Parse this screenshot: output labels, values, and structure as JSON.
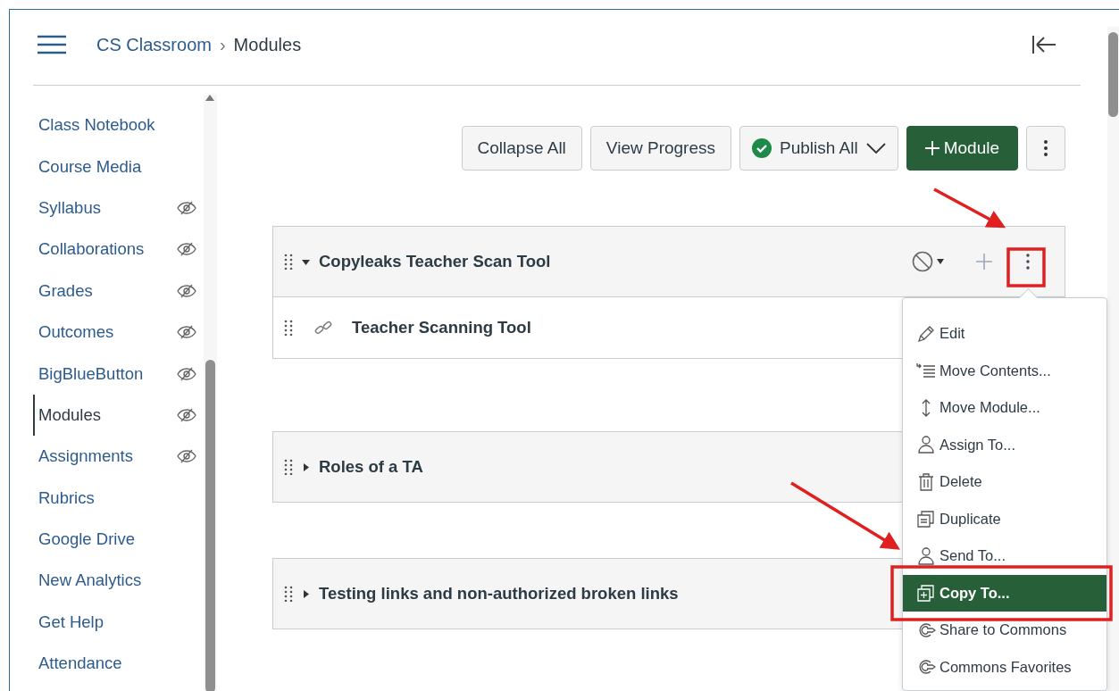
{
  "breadcrumb": {
    "course": "CS Classroom",
    "separator": "›",
    "page": "Modules"
  },
  "sidebar": {
    "items": [
      {
        "label": "Class Notebook",
        "selected": false,
        "hidden": false
      },
      {
        "label": "Course Media",
        "selected": false,
        "hidden": false
      },
      {
        "label": "Syllabus",
        "selected": false,
        "hidden": true
      },
      {
        "label": "Collaborations",
        "selected": false,
        "hidden": true
      },
      {
        "label": "Grades",
        "selected": false,
        "hidden": true
      },
      {
        "label": "Outcomes",
        "selected": false,
        "hidden": true
      },
      {
        "label": "BigBlueButton",
        "selected": false,
        "hidden": true
      },
      {
        "label": "Modules",
        "selected": true,
        "hidden": true
      },
      {
        "label": "Assignments",
        "selected": false,
        "hidden": true
      },
      {
        "label": "Rubrics",
        "selected": false,
        "hidden": false
      },
      {
        "label": "Google Drive",
        "selected": false,
        "hidden": false
      },
      {
        "label": "New Analytics",
        "selected": false,
        "hidden": false
      },
      {
        "label": "Get Help",
        "selected": false,
        "hidden": false
      },
      {
        "label": "Attendance",
        "selected": false,
        "hidden": false
      }
    ]
  },
  "toolbar": {
    "collapse_all": "Collapse All",
    "view_progress": "View Progress",
    "publish_all": "Publish All",
    "add_module": "Module"
  },
  "modules": [
    {
      "title": "Copyleaks Teacher Scan Tool",
      "expanded": true,
      "items": [
        {
          "title": "Teacher Scanning Tool"
        }
      ]
    },
    {
      "title": "Roles of a TA",
      "expanded": false
    },
    {
      "title": "Testing links and non-authorized broken links",
      "expanded": false
    }
  ],
  "module_menu": {
    "items": [
      {
        "kind": "edit",
        "label": "Edit",
        "selected": false
      },
      {
        "kind": "move-contents",
        "label": "Move Contents...",
        "selected": false
      },
      {
        "kind": "move-module",
        "label": "Move Module...",
        "selected": false
      },
      {
        "kind": "assign",
        "label": "Assign To...",
        "selected": false
      },
      {
        "kind": "delete",
        "label": "Delete",
        "selected": false
      },
      {
        "kind": "duplicate",
        "label": "Duplicate",
        "selected": false
      },
      {
        "kind": "send",
        "label": "Send To...",
        "selected": false
      },
      {
        "kind": "copy",
        "label": "Copy To...",
        "selected": true
      },
      {
        "kind": "share",
        "label": "Share to Commons",
        "selected": false
      },
      {
        "kind": "favorites",
        "label": "Commons Favorites",
        "selected": false
      }
    ]
  }
}
